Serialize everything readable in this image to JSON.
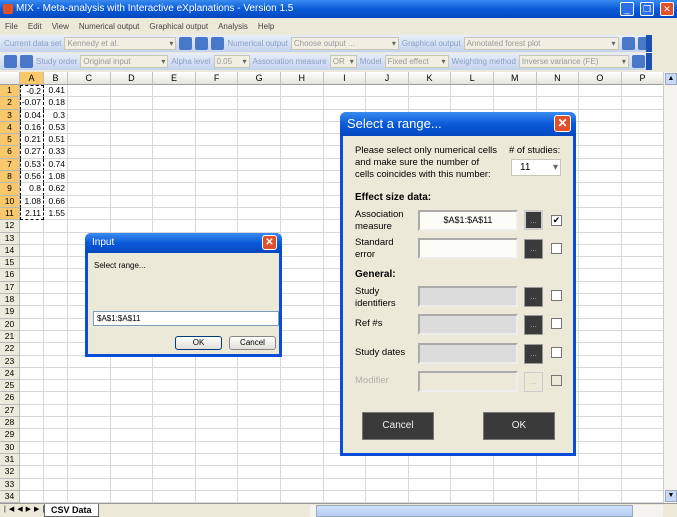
{
  "window": {
    "title": "MIX - Meta-analysis with Interactive eXplanations - Version 1.5"
  },
  "menu": [
    "File",
    "Edit",
    "View",
    "Numerical output",
    "Graphical output",
    "Analysis",
    "Help"
  ],
  "toolbar1": {
    "dataset_label": "Current data set",
    "dataset_value": "Kennedy et al.",
    "numerical_label": "Numerical output",
    "numerical_value": "Choose output ...",
    "graphical_label": "Graphical output",
    "graphical_value": "Annotated forest plot"
  },
  "toolbar2": {
    "order_label": "Study order",
    "order_value": "Original input",
    "alpha_label": "Alpha level",
    "alpha_value": "0.05",
    "assoc_label": "Association measure",
    "assoc_value": "OR",
    "model_label": "Model",
    "model_value": "Fixed effect",
    "weight_label": "Weighting method",
    "weight_value": "Inverse variance (FE)"
  },
  "columns": [
    "A",
    "B",
    "C",
    "D",
    "E",
    "F",
    "G",
    "H",
    "I",
    "J",
    "K",
    "L",
    "M",
    "N",
    "O",
    "P"
  ],
  "row_count": 35,
  "cells": {
    "A": [
      "-0.2",
      "-0.07",
      "0.04",
      "0.16",
      "0.21",
      "0.27",
      "0.53",
      "0.56",
      "0.8",
      "1.08",
      "2.11"
    ],
    "B": [
      "0.41",
      "0.18",
      "0.3",
      "0.53",
      "0.51",
      "0.33",
      "0.74",
      "1.08",
      "0.62",
      "0.66",
      "1.55"
    ]
  },
  "sheet_tab": "CSV Data",
  "select_dialog": {
    "title": "Select a range...",
    "instructions": "Please select only numerical cells and make sure the number of cells coincides with this number:",
    "studies_label": "# of studies:",
    "studies_value": "11",
    "effect_heading": "Effect size data:",
    "assoc_label": "Association measure",
    "assoc_value": "$A$1:$A$11",
    "assoc_checked": true,
    "se_label": "Standard error",
    "general_heading": "General:",
    "study_ids_label": "Study identifiers",
    "refs_label": "Ref #s",
    "dates_label": "Study dates",
    "modifier_label": "Modifier",
    "browse_label": "...",
    "cancel": "Cancel",
    "ok": "OK"
  },
  "input_dialog": {
    "title": "Input",
    "prompt": "Select range...",
    "value": "$A$1:$A$11",
    "ok": "OK",
    "cancel": "Cancel"
  }
}
